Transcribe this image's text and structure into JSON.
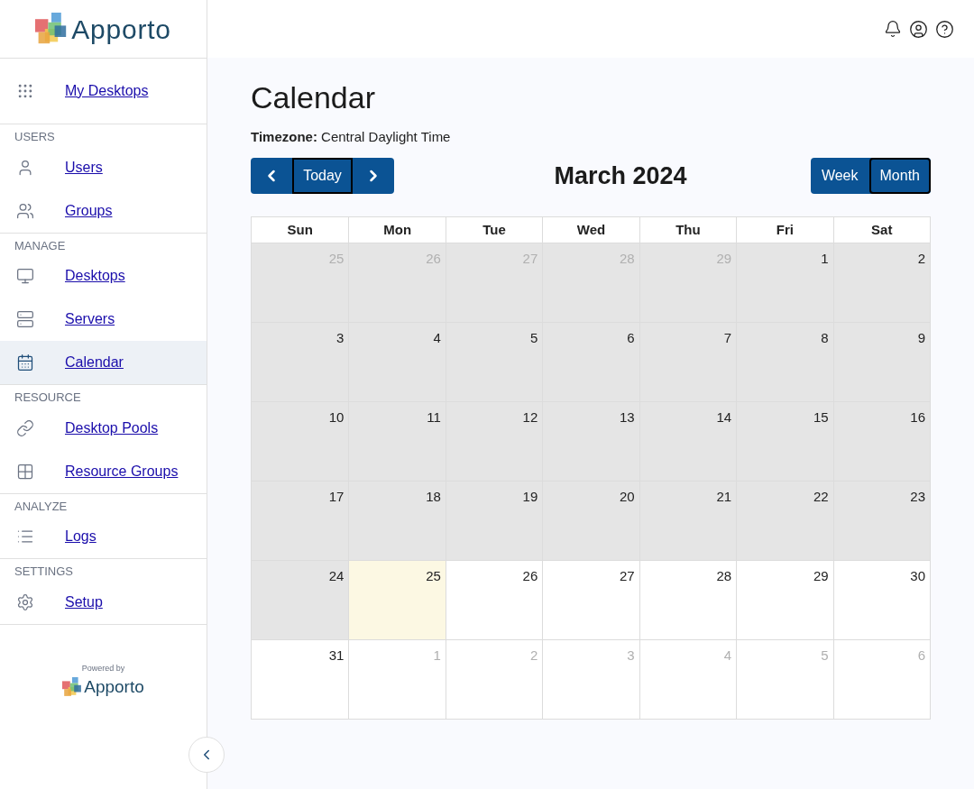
{
  "brand": {
    "name": "Apporto",
    "powered_by": "Powered by",
    "footer_name": "Apporto"
  },
  "sidebar": {
    "top_item": {
      "label": "My Desktops",
      "kind": "grid",
      "selected": false
    },
    "sections": [
      {
        "heading": "USERS",
        "items": [
          {
            "label": "Users",
            "kind": "user",
            "selected": false
          },
          {
            "label": "Groups",
            "kind": "users",
            "selected": false
          }
        ]
      },
      {
        "heading": "MANAGE",
        "items": [
          {
            "label": "Desktops",
            "kind": "monitor",
            "selected": false
          },
          {
            "label": "Servers",
            "kind": "server",
            "selected": false
          },
          {
            "label": "Calendar",
            "kind": "calendar",
            "selected": true
          }
        ]
      },
      {
        "heading": "RESOURCE",
        "items": [
          {
            "label": "Desktop Pools",
            "kind": "pool",
            "selected": false
          },
          {
            "label": "Resource Groups",
            "kind": "squares",
            "selected": false
          }
        ]
      },
      {
        "heading": "ANALYZE",
        "items": [
          {
            "label": "Logs",
            "kind": "list",
            "selected": false
          }
        ]
      },
      {
        "heading": "SETTINGS",
        "items": [
          {
            "label": "Setup",
            "kind": "gear",
            "selected": false
          }
        ]
      }
    ]
  },
  "page": {
    "title": "Calendar",
    "timezone_label": "Timezone:",
    "timezone": "Central Daylight Time"
  },
  "toolbar": {
    "nav": [
      {
        "kind": "prev",
        "focused": false
      },
      {
        "kind": "today",
        "label": "Today",
        "focused": true
      },
      {
        "kind": "next",
        "focused": false
      }
    ],
    "month": "March 2024",
    "views": [
      {
        "label": "Week",
        "selected": false
      },
      {
        "label": "Month",
        "selected": true
      }
    ]
  },
  "calendar": {
    "weekdays": [
      "Sun",
      "Mon",
      "Tue",
      "Wed",
      "Thu",
      "Fri",
      "Sat"
    ],
    "weeks": [
      [
        {
          "day": "25",
          "outside": true,
          "past": true,
          "today": false
        },
        {
          "day": "26",
          "outside": true,
          "past": true,
          "today": false
        },
        {
          "day": "27",
          "outside": true,
          "past": true,
          "today": false
        },
        {
          "day": "28",
          "outside": true,
          "past": true,
          "today": false
        },
        {
          "day": "29",
          "outside": true,
          "past": true,
          "today": false
        },
        {
          "day": "1",
          "outside": false,
          "past": true,
          "today": false
        },
        {
          "day": "2",
          "outside": false,
          "past": true,
          "today": false
        }
      ],
      [
        {
          "day": "3",
          "outside": false,
          "past": true,
          "today": false
        },
        {
          "day": "4",
          "outside": false,
          "past": true,
          "today": false
        },
        {
          "day": "5",
          "outside": false,
          "past": true,
          "today": false
        },
        {
          "day": "6",
          "outside": false,
          "past": true,
          "today": false
        },
        {
          "day": "7",
          "outside": false,
          "past": true,
          "today": false
        },
        {
          "day": "8",
          "outside": false,
          "past": true,
          "today": false
        },
        {
          "day": "9",
          "outside": false,
          "past": true,
          "today": false
        }
      ],
      [
        {
          "day": "10",
          "outside": false,
          "past": true,
          "today": false
        },
        {
          "day": "11",
          "outside": false,
          "past": true,
          "today": false
        },
        {
          "day": "12",
          "outside": false,
          "past": true,
          "today": false
        },
        {
          "day": "13",
          "outside": false,
          "past": true,
          "today": false
        },
        {
          "day": "14",
          "outside": false,
          "past": true,
          "today": false
        },
        {
          "day": "15",
          "outside": false,
          "past": true,
          "today": false
        },
        {
          "day": "16",
          "outside": false,
          "past": true,
          "today": false
        }
      ],
      [
        {
          "day": "17",
          "outside": false,
          "past": true,
          "today": false
        },
        {
          "day": "18",
          "outside": false,
          "past": true,
          "today": false
        },
        {
          "day": "19",
          "outside": false,
          "past": true,
          "today": false
        },
        {
          "day": "20",
          "outside": false,
          "past": true,
          "today": false
        },
        {
          "day": "21",
          "outside": false,
          "past": true,
          "today": false
        },
        {
          "day": "22",
          "outside": false,
          "past": true,
          "today": false
        },
        {
          "day": "23",
          "outside": false,
          "past": true,
          "today": false
        }
      ],
      [
        {
          "day": "24",
          "outside": false,
          "past": true,
          "today": false
        },
        {
          "day": "25",
          "outside": false,
          "past": false,
          "today": true
        },
        {
          "day": "26",
          "outside": false,
          "past": false,
          "today": false
        },
        {
          "day": "27",
          "outside": false,
          "past": false,
          "today": false
        },
        {
          "day": "28",
          "outside": false,
          "past": false,
          "today": false
        },
        {
          "day": "29",
          "outside": false,
          "past": false,
          "today": false
        },
        {
          "day": "30",
          "outside": false,
          "past": false,
          "today": false
        }
      ],
      [
        {
          "day": "31",
          "outside": false,
          "past": false,
          "today": false
        },
        {
          "day": "1",
          "outside": true,
          "past": false,
          "today": false
        },
        {
          "day": "2",
          "outside": true,
          "past": false,
          "today": false
        },
        {
          "day": "3",
          "outside": true,
          "past": false,
          "today": false
        },
        {
          "day": "4",
          "outside": true,
          "past": false,
          "today": false
        },
        {
          "day": "5",
          "outside": true,
          "past": false,
          "today": false
        },
        {
          "day": "6",
          "outside": true,
          "past": false,
          "today": false
        }
      ]
    ]
  }
}
